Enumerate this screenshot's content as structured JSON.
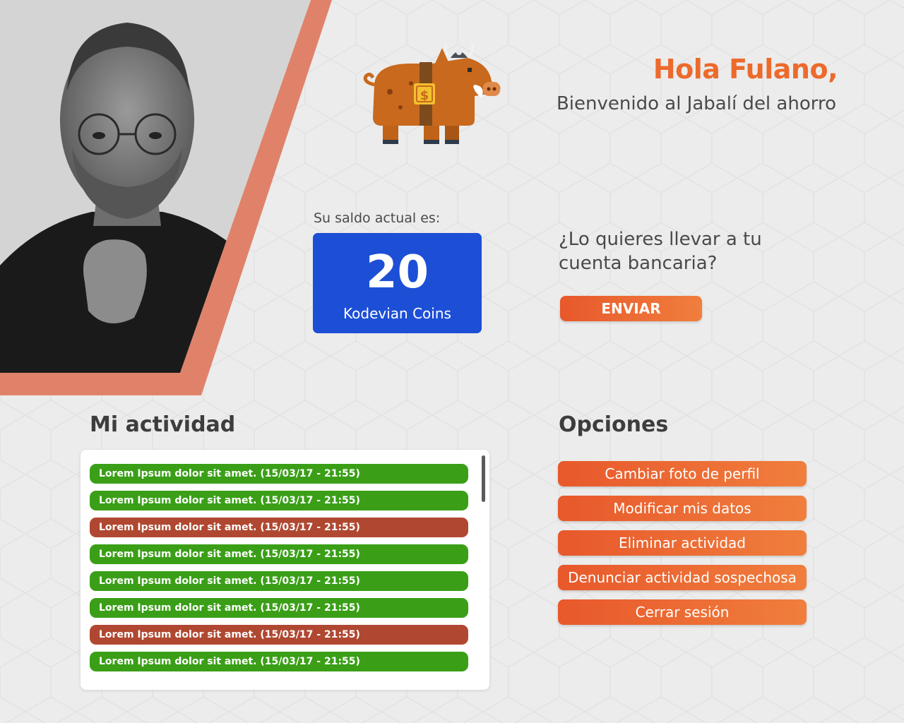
{
  "greeting": {
    "title": "Hola Fulano,",
    "subtitle": "Bienvenido al Jabalí del ahorro"
  },
  "balance": {
    "label": "Su saldo actual es:",
    "amount": "20",
    "unit": "Kodevian Coins"
  },
  "transfer": {
    "question": "¿Lo quieres llevar a tu cuenta bancaria?",
    "button_label": "ENVIAR"
  },
  "activity": {
    "title": "Mi actividad",
    "items": [
      {
        "text": "Lorem Ipsum dolor sit amet. (15/03/17 - 21:55)",
        "status": "ok"
      },
      {
        "text": "Lorem Ipsum dolor sit amet. (15/03/17 - 21:55)",
        "status": "ok"
      },
      {
        "text": "Lorem Ipsum dolor sit amet. (15/03/17 - 21:55)",
        "status": "bad"
      },
      {
        "text": "Lorem Ipsum dolor sit amet. (15/03/17 - 21:55)",
        "status": "ok"
      },
      {
        "text": "Lorem Ipsum dolor sit amet. (15/03/17 - 21:55)",
        "status": "ok"
      },
      {
        "text": "Lorem Ipsum dolor sit amet. (15/03/17 - 21:55)",
        "status": "ok"
      },
      {
        "text": "Lorem Ipsum dolor sit amet. (15/03/17 - 21:55)",
        "status": "bad"
      },
      {
        "text": "Lorem Ipsum dolor sit amet. (15/03/17 - 21:55)",
        "status": "ok"
      }
    ]
  },
  "options": {
    "title": "Opciones",
    "buttons": [
      "Cambiar foto de perfil",
      "Modificar mis datos",
      "Eliminar actividad",
      "Denunciar actividad sospechosa",
      "Cerrar sesión"
    ]
  },
  "icons": {
    "mascot": "boar-mascot-icon",
    "profile": "profile-photo"
  },
  "colors": {
    "accent": "#ec6a2c",
    "balance_card": "#1d4fd6",
    "activity_ok": "#3a9f17",
    "activity_bad": "#b04831",
    "stripe": "#e0826a"
  }
}
